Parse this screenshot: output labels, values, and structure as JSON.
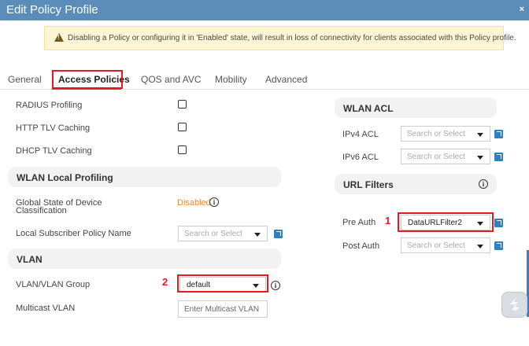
{
  "window": {
    "title": "Edit Policy Profile",
    "close": "×"
  },
  "banner": {
    "message": "Disabling a Policy or configuring it in 'Enabled' state, will result in loss of connectivity for clients associated with this Policy profile."
  },
  "tabs": [
    "General",
    "Access Policies",
    "QOS and AVC",
    "Mobility",
    "Advanced"
  ],
  "left": {
    "radius_profiling": "RADIUS Profiling",
    "http_tlv": "HTTP TLV Caching",
    "dhcp_tlv": "DHCP TLV Caching",
    "wlan_local_profiling": "WLAN Local Profiling",
    "global_state_line1": "Global State of Device",
    "global_state_line2": "Classification",
    "global_state_value": "Disabled",
    "local_subscriber": "Local Subscriber Policy Name",
    "local_subscriber_placeholder": "Search or Select",
    "vlan_section": "VLAN",
    "vlan_group": "VLAN/VLAN Group",
    "vlan_group_value": "default",
    "multicast_vlan": "Multicast VLAN",
    "multicast_placeholder": "Enter Multicast VLAN"
  },
  "right": {
    "wlan_acl": "WLAN ACL",
    "ipv4_acl": "IPv4 ACL",
    "ipv4_placeholder": "Search or Select",
    "ipv6_acl": "IPv6 ACL",
    "ipv6_placeholder": "Search or Select",
    "url_filters": "URL Filters",
    "pre_auth": "Pre Auth",
    "pre_auth_value": "DataURLFilter2",
    "post_auth": "Post Auth",
    "post_auth_placeholder": "Search or Select"
  },
  "annotations": {
    "one": "1",
    "two": "2"
  },
  "info_glyph": "i",
  "colors": {
    "titlebar": "#5b8db8",
    "annotation_red": "#e51b24",
    "disabled_orange": "#e8883a",
    "edit_icon": "#2f7fc1"
  }
}
